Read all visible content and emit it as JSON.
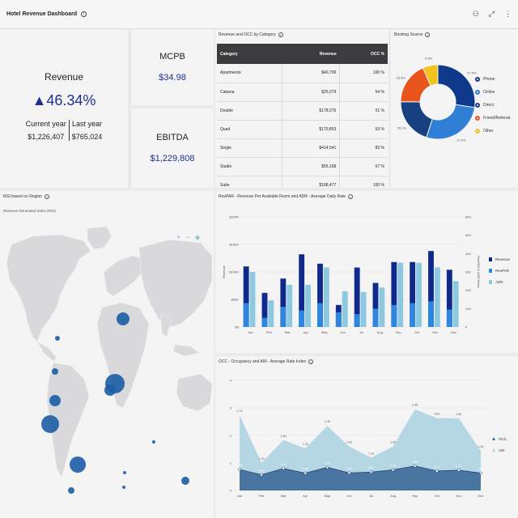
{
  "app": {
    "title": "Hotel Revenue Dashboard",
    "info_icon": "info-icon",
    "actions": [
      "focus-mode-icon",
      "expand-icon",
      "more-options-icon"
    ]
  },
  "kpi_revenue": {
    "label": "Revenue",
    "change": "▲46.34%",
    "current_label": "Current year",
    "last_label": "Last year",
    "current_value": "$1,226,407",
    "last_value": "$765,024",
    "accent": "#1e2f8d"
  },
  "kpi_mcpb": {
    "label": "MCPB",
    "value": "$34.98"
  },
  "kpi_ebitda": {
    "label": "EBITDA",
    "value": "$1,229,808"
  },
  "category_table": {
    "title": "Revenue and OCC by Category",
    "columns": [
      "Category",
      "Revenue",
      "OCC %"
    ],
    "rows": [
      [
        "Apartments",
        "$40,706",
        "100 %"
      ],
      [
        "Cabana",
        "$25,079",
        "54 %"
      ],
      [
        "Double",
        "$178,075",
        "51 %"
      ],
      [
        "Quad",
        "$170,853",
        "63 %"
      ],
      [
        "Single",
        "$414,541",
        "83 %"
      ],
      [
        "Studio",
        "$55,168",
        "67 %"
      ],
      [
        "Suite",
        "$188,477",
        "100 %"
      ]
    ]
  },
  "booking_source": {
    "title": "Booking Source",
    "legend": [
      "Phone",
      "Online",
      "Direct",
      "Friend/Referral",
      "Other"
    ],
    "chart_data": {
      "type": "pie",
      "categories": [
        "Phone",
        "Online",
        "Direct",
        "Friend/Referral",
        "Other"
      ],
      "values": [
        27.4,
        27.6,
        20.1,
        18.3,
        6.6
      ],
      "labels": [
        "27.4%",
        "27.6%",
        "20.1%",
        "18.3%",
        "6.6%"
      ],
      "colors": [
        "#0f3a8c",
        "#2f7fd6",
        "#16407f",
        "#e8541b",
        "#f2c31b"
      ]
    }
  },
  "rgi_map": {
    "title": "RGI based on Region",
    "subtitle": "Revenue Generated Index (RGI)",
    "controls": [
      "add-icon",
      "minus-icon",
      "reset-view-icon"
    ],
    "bubble_color": "#1f5fa6"
  },
  "revpar_chart": {
    "title": "RevPAR - Revenue Per Available Room and ADR - Average Daily Rate",
    "legend": [
      "Revenue",
      "RevPAR",
      "ADR"
    ],
    "chart_data": {
      "type": "bar",
      "categories": [
        "Jan",
        "Feb",
        "Mar",
        "Apr",
        "May",
        "Jun",
        "Jul",
        "Aug",
        "Sep",
        "Oct",
        "Nov",
        "Dec"
      ],
      "ylabel": "Revenue",
      "y2label": "RevPAR & ADR Rates",
      "ylim": [
        0,
        200000
      ],
      "yticks": [
        "$0",
        "$50K",
        "$100K",
        "$150K",
        "$200K"
      ],
      "y2lim": [
        0,
        600
      ],
      "y2ticks": [
        "0",
        "100",
        "200",
        "300",
        "400",
        "500",
        "600"
      ],
      "series": [
        {
          "name": "Revenue",
          "axis": "left",
          "color": "#0f2a8a",
          "values": [
            110000,
            62000,
            88000,
            132000,
            115000,
            40000,
            108000,
            80000,
            118000,
            118000,
            138000,
            104000
          ]
        },
        {
          "name": "RevPAR",
          "axis": "right",
          "color": "#2e86de",
          "values": [
            130,
            50,
            110,
            90,
            130,
            80,
            70,
            100,
            120,
            130,
            140,
            95
          ]
        },
        {
          "name": "ADR",
          "axis": "right",
          "color": "#8cc9e0",
          "values": [
            300,
            145,
            230,
            230,
            325,
            195,
            190,
            215,
            350,
            350,
            325,
            250
          ]
        }
      ]
    }
  },
  "occ_chart": {
    "title": "OCC - Occupancy and ARI - Average Rate Index",
    "legend": [
      "OCC",
      "ARI"
    ],
    "chart_data": {
      "type": "area",
      "categories": [
        "Jan",
        "Feb",
        "Mar",
        "Apr",
        "May",
        "Jun",
        "Jul",
        "Aug",
        "Sep",
        "Oct",
        "Nov",
        "Dec"
      ],
      "ylim": [
        0,
        4
      ],
      "yticks": [
        "0",
        "1",
        "2",
        "3",
        "4"
      ],
      "series": [
        {
          "name": "OCC",
          "color": "#3e6a99",
          "values": [
            0.76,
            0.57,
            0.8,
            0.63,
            0.84,
            0.64,
            0.67,
            0.75,
            0.89,
            0.71,
            0.74,
            0.63
          ],
          "labels": [
            "0.76",
            "0.57",
            "0.80",
            "0.63",
            "0.84",
            "0.64",
            "0.67",
            "0.75",
            "0.89",
            "0.71",
            "0.74",
            "0.63"
          ]
        },
        {
          "name": "ARI",
          "color": "#a9d1df",
          "values": [
            2.74,
            1.0,
            1.83,
            1.53,
            2.35,
            1.6,
            1.19,
            1.6,
            2.95,
            2.63,
            2.62,
            1.44
          ],
          "labels": [
            "2.74",
            "1.00",
            "1.83",
            "1.53",
            "2.35",
            "1.60",
            "1.19",
            "1.60",
            "2.95",
            "2.63",
            "2.62",
            "1.44"
          ]
        }
      ]
    }
  }
}
